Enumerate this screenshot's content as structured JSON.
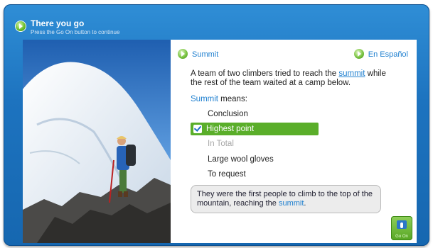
{
  "header": {
    "title": "There you go",
    "subtitle": "Press the Go On button to continue"
  },
  "panel": {
    "word_link": "Summit",
    "language_link": "En Español",
    "sentence_before": "A team of two climbers tried to reach the ",
    "sentence_keyword": "summit",
    "sentence_after": " while the rest of the team waited at a camp below.",
    "means_keyword": "Summit",
    "means_suffix": " means:",
    "options": [
      {
        "label": "Conclusion",
        "state": "normal"
      },
      {
        "label": "Highest point",
        "state": "selected"
      },
      {
        "label": "In Total",
        "state": "dim"
      },
      {
        "label": "Large wool gloves",
        "state": "normal"
      },
      {
        "label": "To request",
        "state": "normal"
      }
    ],
    "context_before": "They were the first people to climb to the top of the mountain, reaching the ",
    "context_keyword": "summit",
    "context_after": ".",
    "go_on_label": "Go On"
  },
  "colors": {
    "frame_blue": "#1d73bf",
    "link_blue": "#1e7fcf",
    "selected_green": "#5aae2a"
  },
  "icons": [
    "play-leaf-icon",
    "checkmark-icon",
    "go-on-hand-icon"
  ]
}
